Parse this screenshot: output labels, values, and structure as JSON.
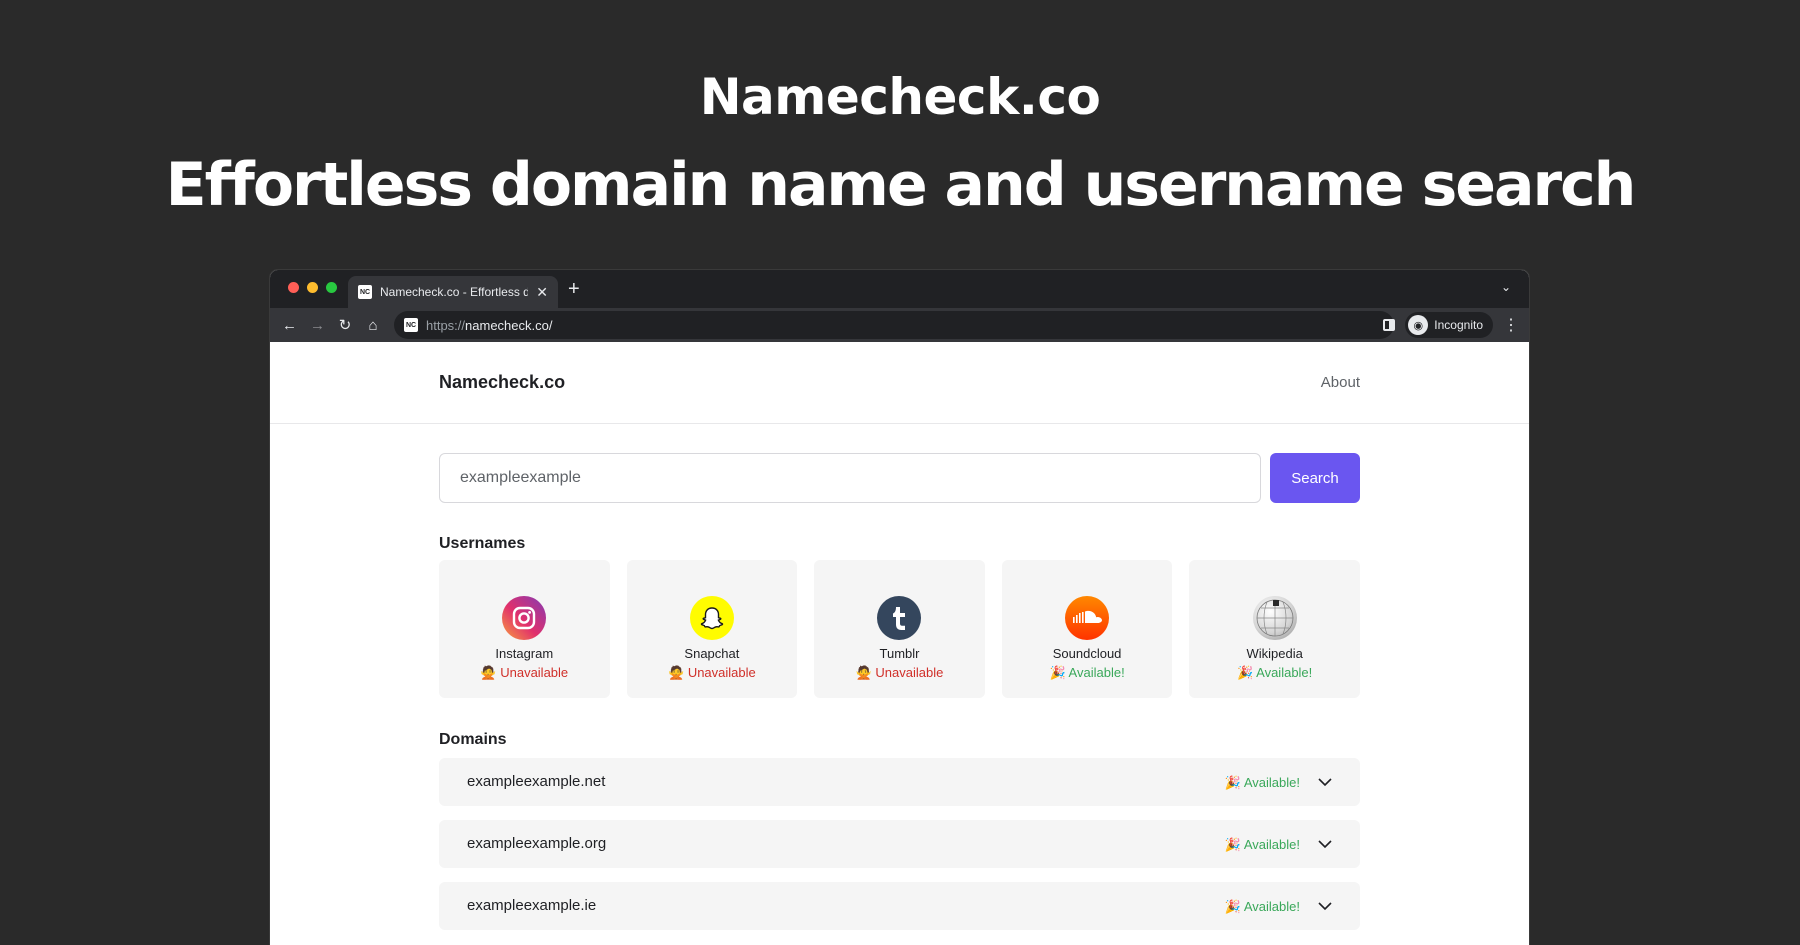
{
  "hero": {
    "brand": "Namecheck.co",
    "title": "Effortless domain name and username search"
  },
  "browser": {
    "tab_title": "Namecheck.co - Effortless domain name and username search",
    "favicon_text": "NC",
    "url_scheme": "https://",
    "url_host": "namecheck.co/",
    "profile_label": "Incognito"
  },
  "site": {
    "brand": "Namecheck.co",
    "nav_about": "About"
  },
  "search": {
    "value": "exampleexample",
    "button_label": "Search"
  },
  "usernames": {
    "title": "Usernames",
    "items": [
      {
        "name": "Instagram",
        "status": "🙅 Unavailable",
        "icon": "instagram-icon"
      },
      {
        "name": "Snapchat",
        "status": "🙅 Unavailable",
        "icon": "snapchat-icon"
      },
      {
        "name": "Tumblr",
        "status": "🙅 Unavailable",
        "icon": "tumblr-icon"
      },
      {
        "name": "Soundcloud",
        "status": "🎉 Available!",
        "icon": "soundcloud-icon"
      },
      {
        "name": "Wikipedia",
        "status": "🎉 Available!",
        "icon": "wikipedia-icon"
      }
    ]
  },
  "domains": {
    "title": "Domains",
    "items": [
      {
        "name": "exampleexample.net",
        "status": "🎉 Available!"
      },
      {
        "name": "exampleexample.org",
        "status": "🎉 Available!"
      },
      {
        "name": "exampleexample.ie",
        "status": "🎉 Available!"
      }
    ]
  },
  "colors": {
    "accent": "#6a56f0",
    "unavailable": "#d0302a",
    "available": "#3aa85a"
  }
}
